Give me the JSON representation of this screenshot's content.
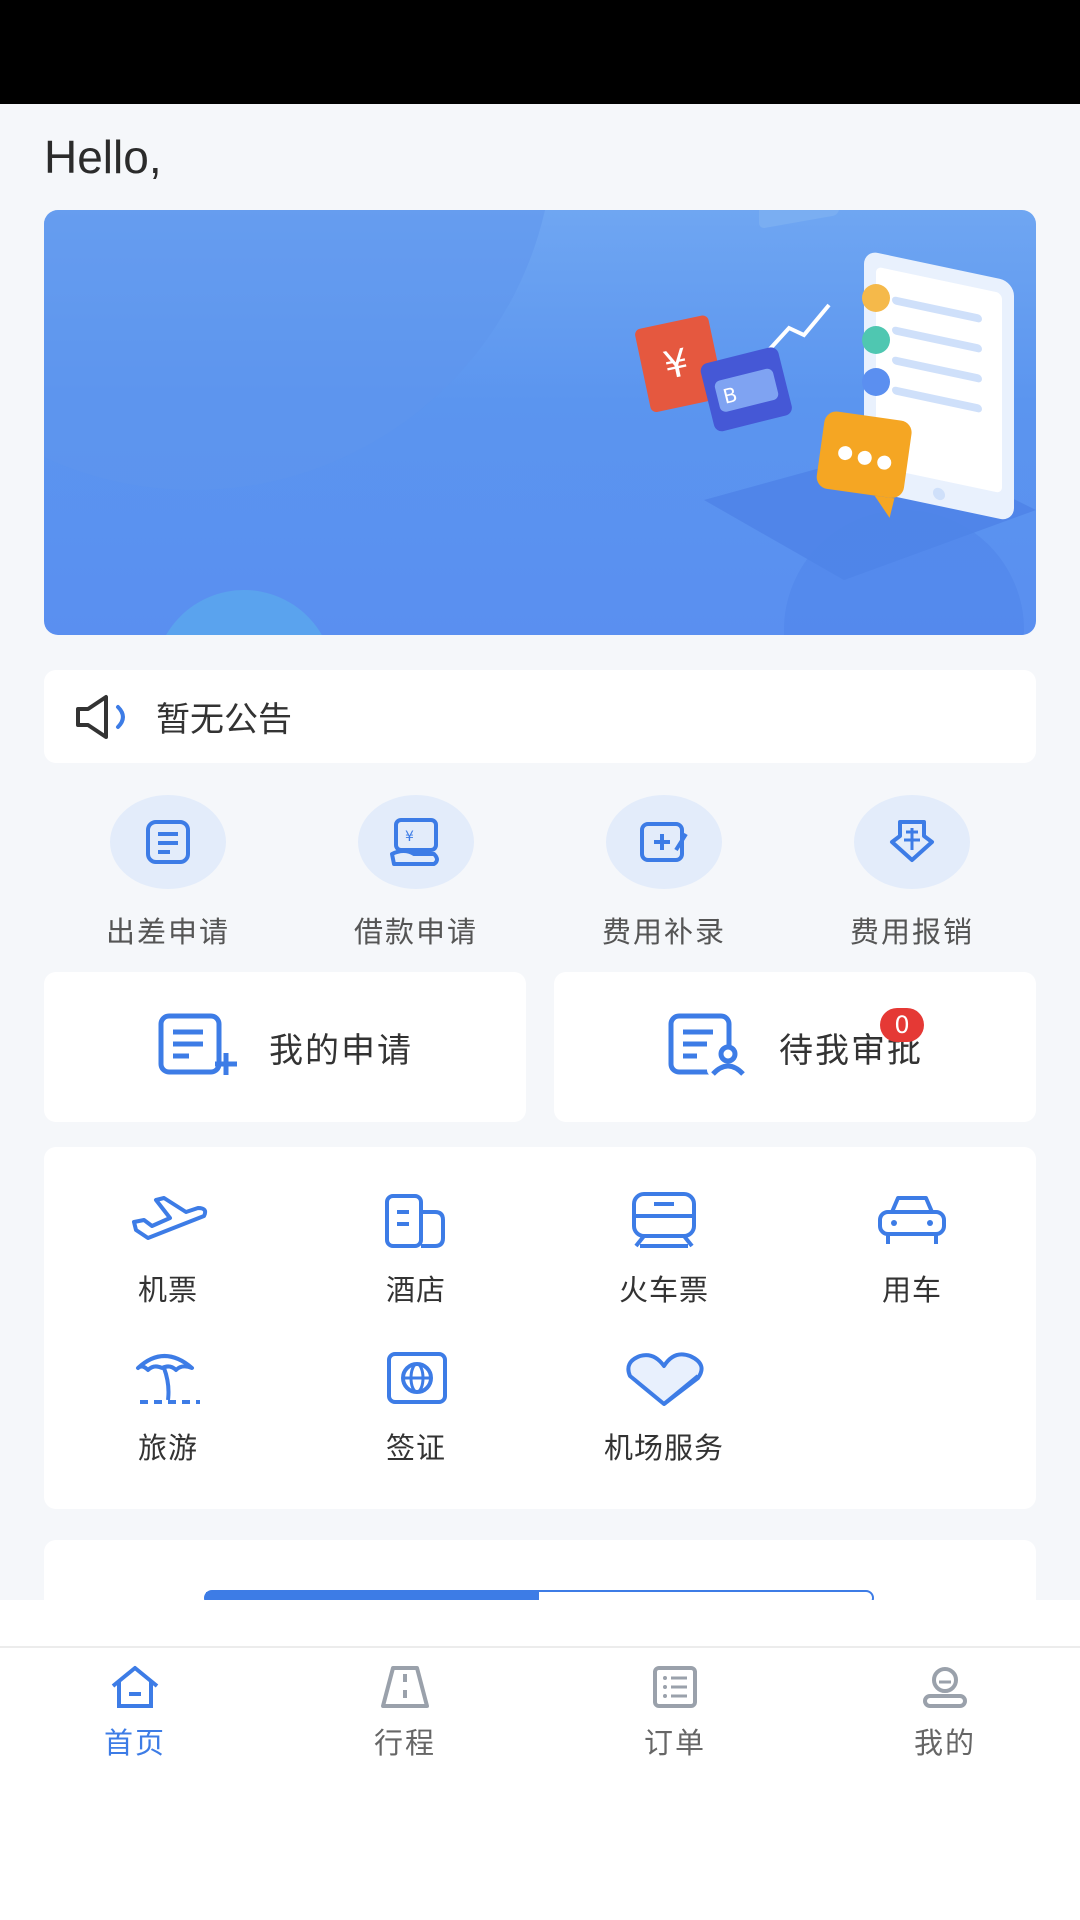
{
  "greeting": "Hello,",
  "notice": {
    "text": "暂无公告"
  },
  "quick_actions": [
    {
      "label": "出差申请",
      "icon": "travel-request-icon"
    },
    {
      "label": "借款申请",
      "icon": "loan-request-icon"
    },
    {
      "label": "费用补录",
      "icon": "expense-supplement-icon"
    },
    {
      "label": "费用报销",
      "icon": "reimbursement-icon"
    }
  ],
  "applications": {
    "my_requests": "我的申请",
    "pending_approval": "待我审批",
    "pending_count": "0"
  },
  "services": [
    {
      "label": "机票",
      "icon": "airplane-icon"
    },
    {
      "label": "酒店",
      "icon": "hotel-icon"
    },
    {
      "label": "火车票",
      "icon": "train-icon"
    },
    {
      "label": "用车",
      "icon": "car-icon"
    },
    {
      "label": "旅游",
      "icon": "palm-tree-icon"
    },
    {
      "label": "签证",
      "icon": "visa-icon"
    },
    {
      "label": "机场服务",
      "icon": "heart-icon"
    }
  ],
  "tabbar": [
    {
      "label": "首页",
      "icon": "home-icon",
      "active": true
    },
    {
      "label": "行程",
      "icon": "road-icon",
      "active": false
    },
    {
      "label": "订单",
      "icon": "order-list-icon",
      "active": false
    },
    {
      "label": "我的",
      "icon": "profile-icon",
      "active": false
    }
  ],
  "colors": {
    "accent": "#3d7ce6",
    "badge": "#e53935",
    "background": "#f5f7fa"
  }
}
